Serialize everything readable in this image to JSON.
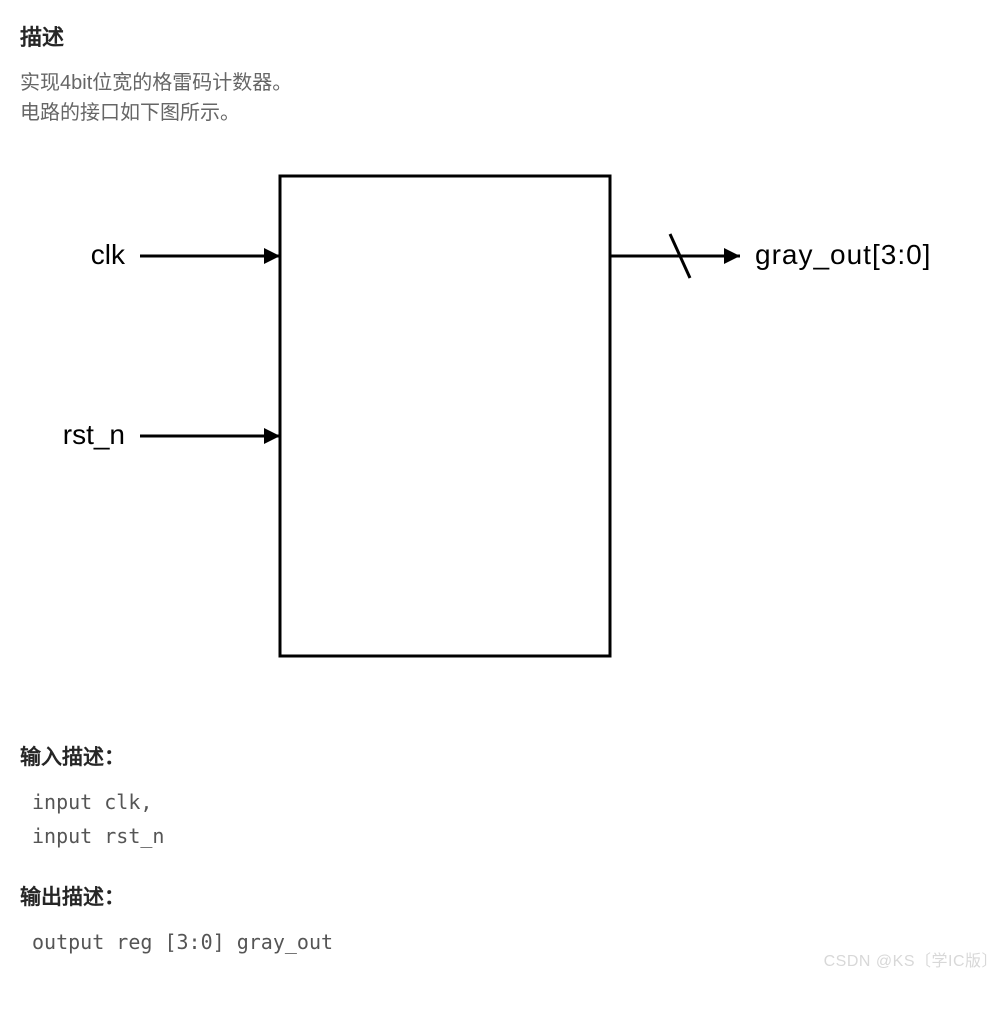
{
  "heading_desc": "描述",
  "desc_line1": "实现4bit位宽的格雷码计数器。",
  "desc_line2": "电路的接口如下图所示。",
  "diagram": {
    "input_top": "clk",
    "input_bottom": "rst_n",
    "output_right": "gray_out[3:0]"
  },
  "heading_input": "输入描述：",
  "input_code_line1": "input   clk,",
  "input_code_line2": "input   rst_n",
  "heading_output": "输出描述：",
  "output_code_line1": "output  reg [3:0] gray_out",
  "watermark": "CSDN @KS〔学IC版〕"
}
